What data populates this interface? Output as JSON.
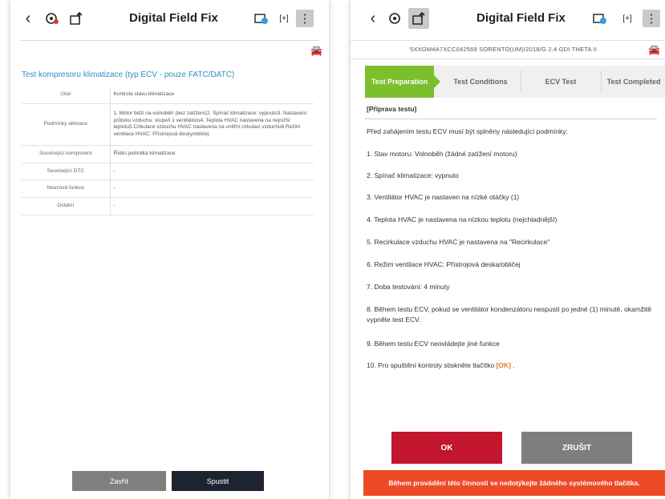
{
  "left": {
    "app_title": "Digital Field Fix",
    "icons": {
      "back": "‹",
      "menu": "⋮",
      "camera": "[+]",
      "car": "🚘"
    },
    "heading": "Test kompresoru klimatizace (typ ECV - pouze FATC/DATC)",
    "rows": [
      {
        "key": "Účel",
        "value": "Kontrola stavu klimatizace"
      },
      {
        "key": "Podmínky aktivace",
        "value": "1. Motor běží na volnoběh (bez zatížení)2. Spínač klimatizace: vypnuto3. Nastavení průtoku vzduchu: stupeň 1 ventilátoru4. Teplota HVAC nastavena na nejnižší teplotu5.Cirkulace vzduchu HVAC nastavena na vnitřní cirkulaci vzduchu6.Režim ventilace HVAC: Přístrojová desky/obličej"
      },
      {
        "key": "Související komponent",
        "value": "Řídicí jednotka klimatizace"
      },
      {
        "key": "Související DTC",
        "value": "-"
      },
      {
        "key": "Nouzová funkce",
        "value": "-"
      },
      {
        "key": "Ostatní",
        "value": "-"
      }
    ],
    "close_label": "Zavřít",
    "start_label": "Spustit"
  },
  "right": {
    "app_title": "Digital Field Fix",
    "icons": {
      "back": "‹",
      "menu": "⋮",
      "camera": "[+]",
      "car": "🚘"
    },
    "vehicle_info": "5XXGM4A7XCC042569 SORENTO(UM)/2018/G 2.4 GDI THETA II",
    "tabs": [
      {
        "label": "Test Preparation",
        "active": true
      },
      {
        "label": "Test Conditions",
        "active": false
      },
      {
        "label": "ECV Test",
        "active": false
      },
      {
        "label": "Test Completed",
        "active": false
      }
    ],
    "section_title": "[Příprava testu]",
    "intro": "Před zahájením testu ECV musí být splněny následující podmínky:",
    "steps": [
      "1. Stav motoru: Volnoběh (žádné zatížení motoru)",
      "2. Spínač klimatizace: vypnuto",
      "3. Ventilátor HVAC je nastaven na nízké otáčky (1)",
      "4. Teplota HVAC je nastavena na nízkou teplotu (nejchladnější)",
      "5. Recirkulace vzduchu HVAC je nastavena na \"Recirkulace\"",
      "6. Režim ventilace HVAC: Přístrojová deska/obličej",
      "7. Doba testování: 4 minuty",
      "8. Během testu ECV, pokud se ventilátor kondenzátoru nespustí po jedné (1) minutě, okamžitě vypněte test ECV.",
      "9. Během testu ECV neovládejte jiné funkce"
    ],
    "step10_prefix": "10. Pro spuštění kontroly stiskněte tlačítko",
    "step10_ok": "[OK]",
    "step10_suffix": ".",
    "ok_label": "OK",
    "cancel_label": "ZRUŠIT",
    "warning": "Během provádění této činnosti se nedotýkejte žádného systémového tlačítka."
  }
}
